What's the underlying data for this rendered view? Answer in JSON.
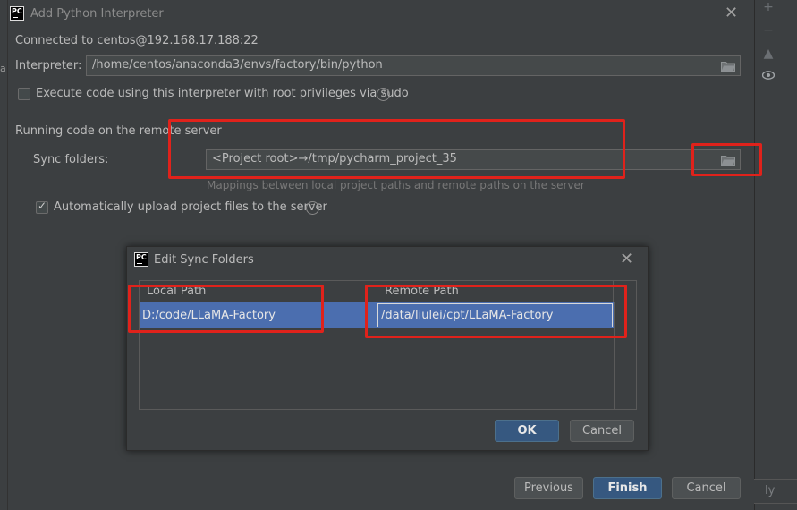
{
  "dialog": {
    "title": "Add Python Interpreter",
    "connected_label": "Connected to centos@192.168.17.188:22",
    "interpreter_label": "Interpreter:",
    "interpreter_value": "/home/centos/anaconda3/envs/factory/bin/python",
    "root_checkbox_label": "Execute code using this interpreter with root privileges via sudo",
    "root_checked": false,
    "section_title": "Running code on the remote server",
    "sync_label": "Sync folders:",
    "sync_value": "<Project root>→/tmp/pycharm_project_35",
    "sync_hint": "Mappings between local project paths and remote paths on the server",
    "auto_upload_label": "Automatically upload project files to the server",
    "auto_upload_checked": true,
    "buttons": {
      "previous": "Previous",
      "finish": "Finish",
      "cancel": "Cancel"
    }
  },
  "edit_sync": {
    "title": "Edit Sync Folders",
    "columns": [
      "Local Path",
      "Remote Path"
    ],
    "rows": [
      {
        "local": "D:/code/LLaMA-Factory",
        "remote": "/data/liulei/cpt/LLaMA-Factory"
      }
    ],
    "buttons": {
      "ok": "OK",
      "cancel": "Cancel"
    }
  },
  "background": {
    "right_button": "ly"
  },
  "icons": {
    "app_logo": "PC",
    "close": "close-icon",
    "folder": "folder-icon",
    "help": "help-icon"
  },
  "colors": {
    "accent": "#365880",
    "selection": "#4b6eaf",
    "annotation_red": "#e0221b"
  }
}
